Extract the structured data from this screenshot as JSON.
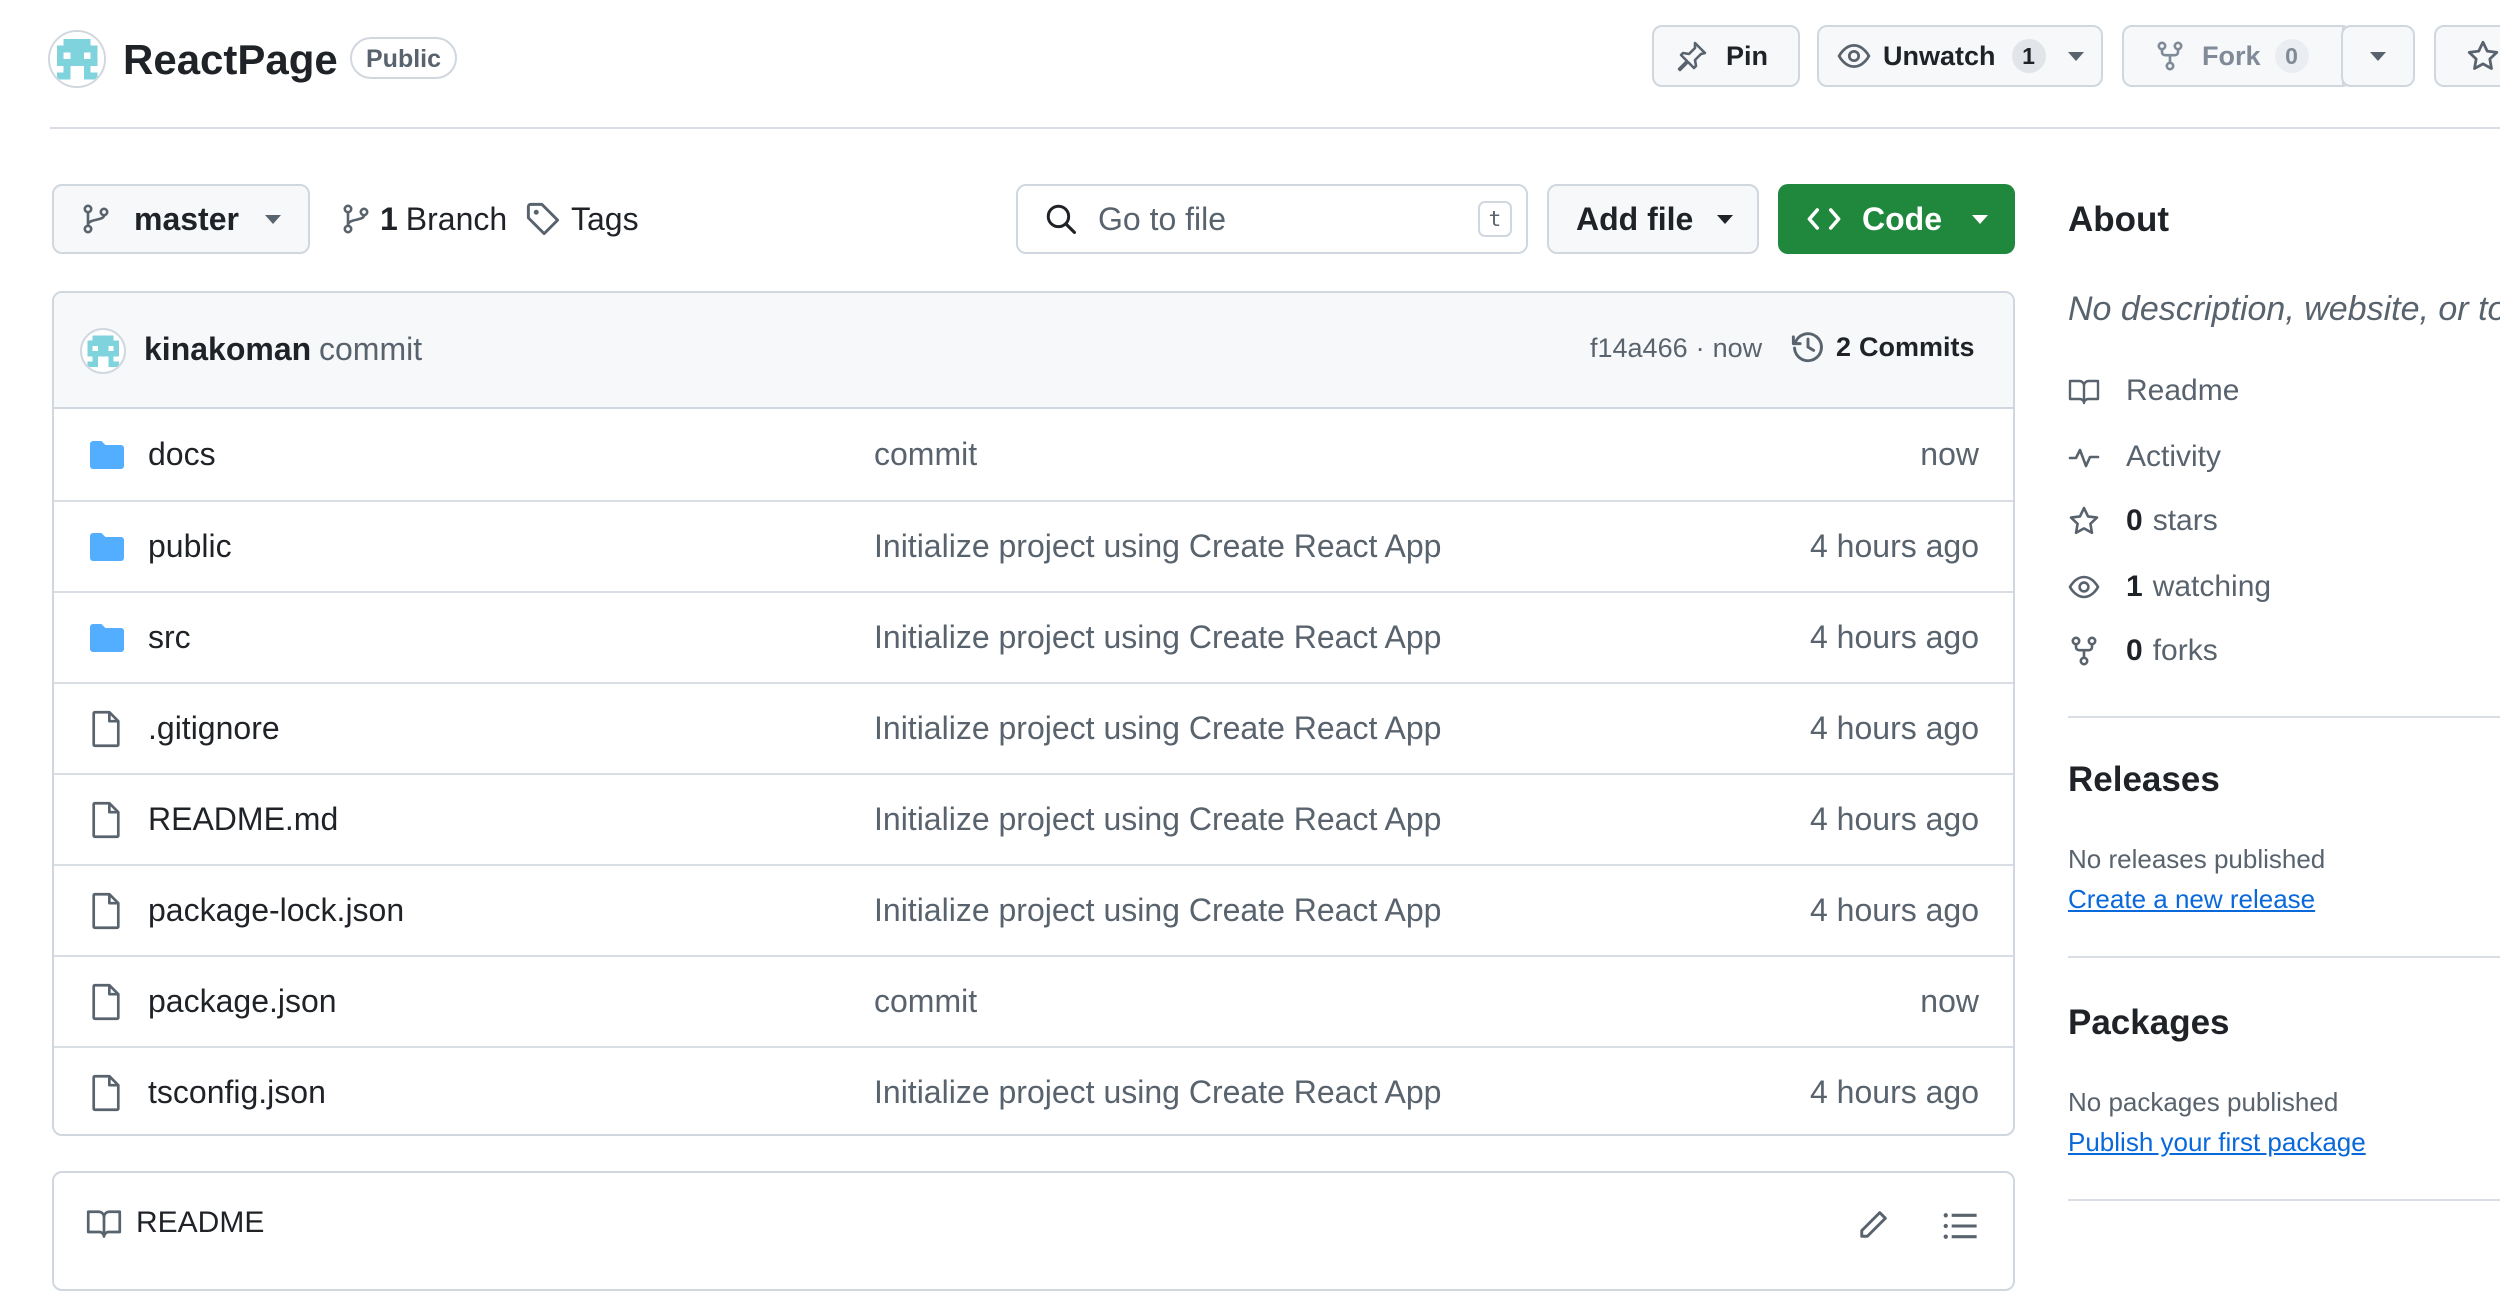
{
  "repo": {
    "name": "ReactPage",
    "visibility": "Public"
  },
  "header_actions": {
    "pin_label": "Pin",
    "unwatch_label": "Unwatch",
    "watch_count": "1",
    "fork_label": "Fork",
    "fork_count": "0"
  },
  "toolbar": {
    "branch": "master",
    "branches_count": "1",
    "branches_label": "Branch",
    "tags_label": "Tags",
    "search_placeholder": "Go to file",
    "search_shortcut": "t",
    "add_file_label": "Add file",
    "code_label": "Code"
  },
  "latest_commit": {
    "author": "kinakoman",
    "message": "commit",
    "sha": "f14a466",
    "separator": "·",
    "time": "now",
    "commits_count": "2",
    "commits_label": "Commits"
  },
  "files": [
    {
      "name": "docs",
      "type": "folder",
      "message": "commit",
      "age": "now"
    },
    {
      "name": "public",
      "type": "folder",
      "message": "Initialize project using Create React App",
      "age": "4 hours ago"
    },
    {
      "name": "src",
      "type": "folder",
      "message": "Initialize project using Create React App",
      "age": "4 hours ago"
    },
    {
      "name": ".gitignore",
      "type": "file",
      "message": "Initialize project using Create React App",
      "age": "4 hours ago"
    },
    {
      "name": "README.md",
      "type": "file",
      "message": "Initialize project using Create React App",
      "age": "4 hours ago"
    },
    {
      "name": "package-lock.json",
      "type": "file",
      "message": "Initialize project using Create React App",
      "age": "4 hours ago"
    },
    {
      "name": "package.json",
      "type": "file",
      "message": "commit",
      "age": "now"
    },
    {
      "name": "tsconfig.json",
      "type": "file",
      "message": "Initialize project using Create React App",
      "age": "4 hours ago"
    }
  ],
  "readme": {
    "label": "README"
  },
  "about": {
    "heading": "About",
    "description": "No description, website, or to",
    "items": [
      {
        "icon": "book-icon",
        "count": "",
        "label": "Readme"
      },
      {
        "icon": "pulse-icon",
        "count": "",
        "label": "Activity"
      },
      {
        "icon": "star-icon",
        "count": "0",
        "label": "stars"
      },
      {
        "icon": "eye-icon",
        "count": "1",
        "label": "watching"
      },
      {
        "icon": "fork-icon",
        "count": "0",
        "label": "forks"
      }
    ]
  },
  "releases": {
    "heading": "Releases",
    "note": "No releases published",
    "link": "Create a new release"
  },
  "packages": {
    "heading": "Packages",
    "note": "No packages published",
    "link": "Publish your first package"
  },
  "colors": {
    "accent_green": "#1f883d",
    "link_blue": "#0969da",
    "folder_blue": "#54aeff",
    "muted_text": "#59636e",
    "border": "#d0d7de"
  }
}
